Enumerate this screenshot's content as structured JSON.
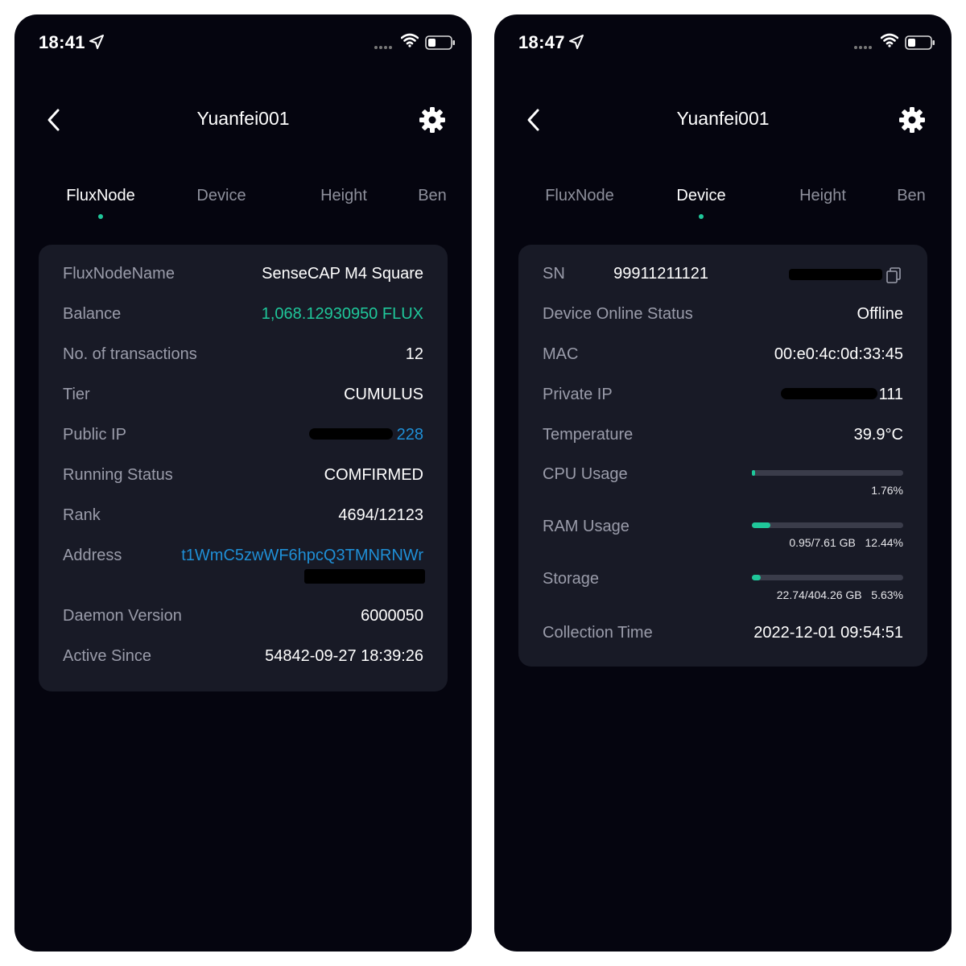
{
  "left": {
    "status_time": "18:41",
    "title": "Yuanfei001",
    "tabs": [
      "FluxNode",
      "Device",
      "Height",
      "Ben"
    ],
    "active_tab": "FluxNode",
    "rows": {
      "name": {
        "label": "FluxNodeName",
        "value": "SenseCAP M4 Square"
      },
      "balance": {
        "label": "Balance",
        "value": "1,068.12930950 FLUX"
      },
      "tx": {
        "label": "No. of transactions",
        "value": "12"
      },
      "tier": {
        "label": "Tier",
        "value": "CUMULUS"
      },
      "ip": {
        "label": "Public IP",
        "value": "228"
      },
      "status": {
        "label": "Running Status",
        "value": "COMFIRMED"
      },
      "rank": {
        "label": "Rank",
        "value": "4694/12123"
      },
      "address": {
        "label": "Address",
        "value": "t1WmC5zwWF6hpcQ3TMNRNWr"
      },
      "daemon": {
        "label": "Daemon Version",
        "value": "6000050"
      },
      "active": {
        "label": "Active Since",
        "value": "54842-09-27 18:39:26"
      }
    }
  },
  "right": {
    "status_time": "18:47",
    "title": "Yuanfei001",
    "tabs": [
      "FluxNode",
      "Device",
      "Height",
      "Ben"
    ],
    "active_tab": "Device",
    "rows": {
      "sn": {
        "label": "SN",
        "value": "99911211121"
      },
      "online": {
        "label": "Device Online Status",
        "value": "Offline"
      },
      "mac": {
        "label": "MAC",
        "value": "00:e0:4c:0d:33:45"
      },
      "private_ip": {
        "label": "Private IP",
        "value": "111"
      },
      "temp": {
        "label": "Temperature",
        "value": "39.9°C"
      },
      "cpu": {
        "label": "CPU Usage",
        "text": "1.76%",
        "percent": 1.76
      },
      "ram": {
        "label": "RAM Usage",
        "text": "0.95/7.61 GB   12.44%",
        "percent": 12.44
      },
      "storage": {
        "label": "Storage",
        "text": "22.74/404.26 GB   5.63%",
        "percent": 5.63
      },
      "collection": {
        "label": "Collection Time",
        "value": "2022-12-01 09:54:51"
      }
    }
  },
  "colors": {
    "accent": "#1fc79a",
    "link": "#1f8fd6",
    "card": "#181a26",
    "background": "#05050f"
  },
  "icons": [
    "location-arrow-icon",
    "signal-dots-icon",
    "wifi-icon",
    "battery-icon",
    "back-chevron-icon",
    "gear-icon",
    "copy-icon"
  ]
}
